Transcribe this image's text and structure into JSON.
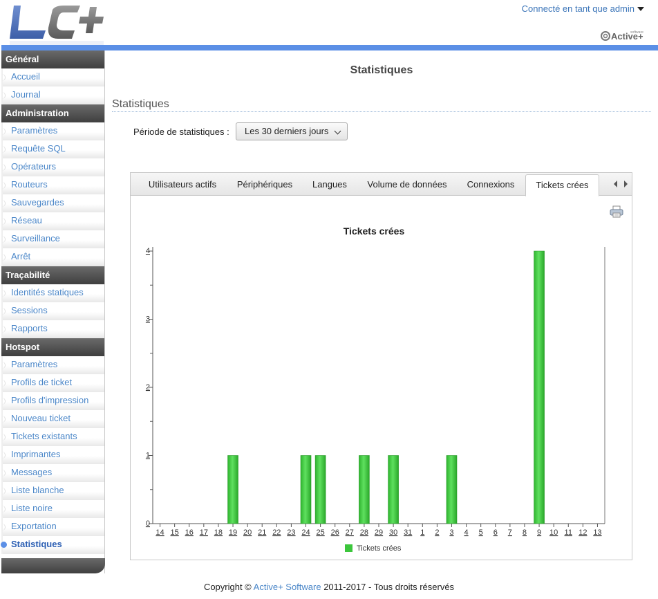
{
  "header": {
    "user_menu_label": "Connecté en tant que admin",
    "logo_text": "LC+",
    "partner_logo_text": "Active+",
    "partner_logo_subtext": "software"
  },
  "sidebar": {
    "sections": [
      {
        "title": "Général",
        "items": [
          "Accueil",
          "Journal"
        ]
      },
      {
        "title": "Administration",
        "items": [
          "Paramètres",
          "Requête SQL",
          "Opérateurs",
          "Routeurs",
          "Sauvegardes",
          "Réseau",
          "Surveillance",
          "Arrêt"
        ]
      },
      {
        "title": "Traçabilité",
        "items": [
          "Identités statiques",
          "Sessions",
          "Rapports"
        ]
      },
      {
        "title": "Hotspot",
        "items": [
          "Paramètres",
          "Profils de ticket",
          "Profils d'impression",
          "Nouveau ticket",
          "Tickets existants",
          "Imprimantes",
          "Messages",
          "Liste blanche",
          "Liste noire",
          "Exportation",
          "Statistiques"
        ]
      }
    ],
    "active_item": "Statistiques"
  },
  "main": {
    "page_title": "Statistiques",
    "section_title": "Statistiques",
    "period_label": "Période de statistiques :",
    "period_value": "Les 30 derniers jours"
  },
  "tabs": [
    {
      "label": "Utilisateurs actifs",
      "active": false
    },
    {
      "label": "Périphériques",
      "active": false
    },
    {
      "label": "Langues",
      "active": false
    },
    {
      "label": "Volume de données",
      "active": false
    },
    {
      "label": "Connexions",
      "active": false
    },
    {
      "label": "Tickets crées",
      "active": true
    }
  ],
  "colors": {
    "accent": "#5b8fe6",
    "link": "#4a86c8",
    "bar": "#3cc63c"
  },
  "chart_data": {
    "type": "bar",
    "title": "Tickets crées",
    "xlabel": "",
    "ylabel": "",
    "categories": [
      "14",
      "15",
      "16",
      "17",
      "18",
      "19",
      "20",
      "21",
      "22",
      "23",
      "24",
      "25",
      "26",
      "27",
      "28",
      "29",
      "30",
      "31",
      "1",
      "2",
      "3",
      "4",
      "5",
      "6",
      "7",
      "8",
      "9",
      "10",
      "11",
      "12",
      "13"
    ],
    "series": [
      {
        "name": "Tickets crées",
        "values": [
          0,
          0,
          0,
          0,
          0,
          1,
          0,
          0,
          0,
          0,
          1,
          1,
          0,
          0,
          1,
          0,
          1,
          0,
          0,
          0,
          1,
          0,
          0,
          0,
          0,
          0,
          4,
          0,
          0,
          0,
          0
        ]
      }
    ],
    "yticks": [
      0,
      1,
      2,
      3,
      4
    ],
    "ylim": [
      0,
      4
    ],
    "legend": "bottom",
    "grid": false
  },
  "footer": {
    "copyright_prefix": "Copyright ©",
    "company_link": "Active+ Software",
    "copyright_suffix": "2011-2017 - Tous droits réservés"
  }
}
